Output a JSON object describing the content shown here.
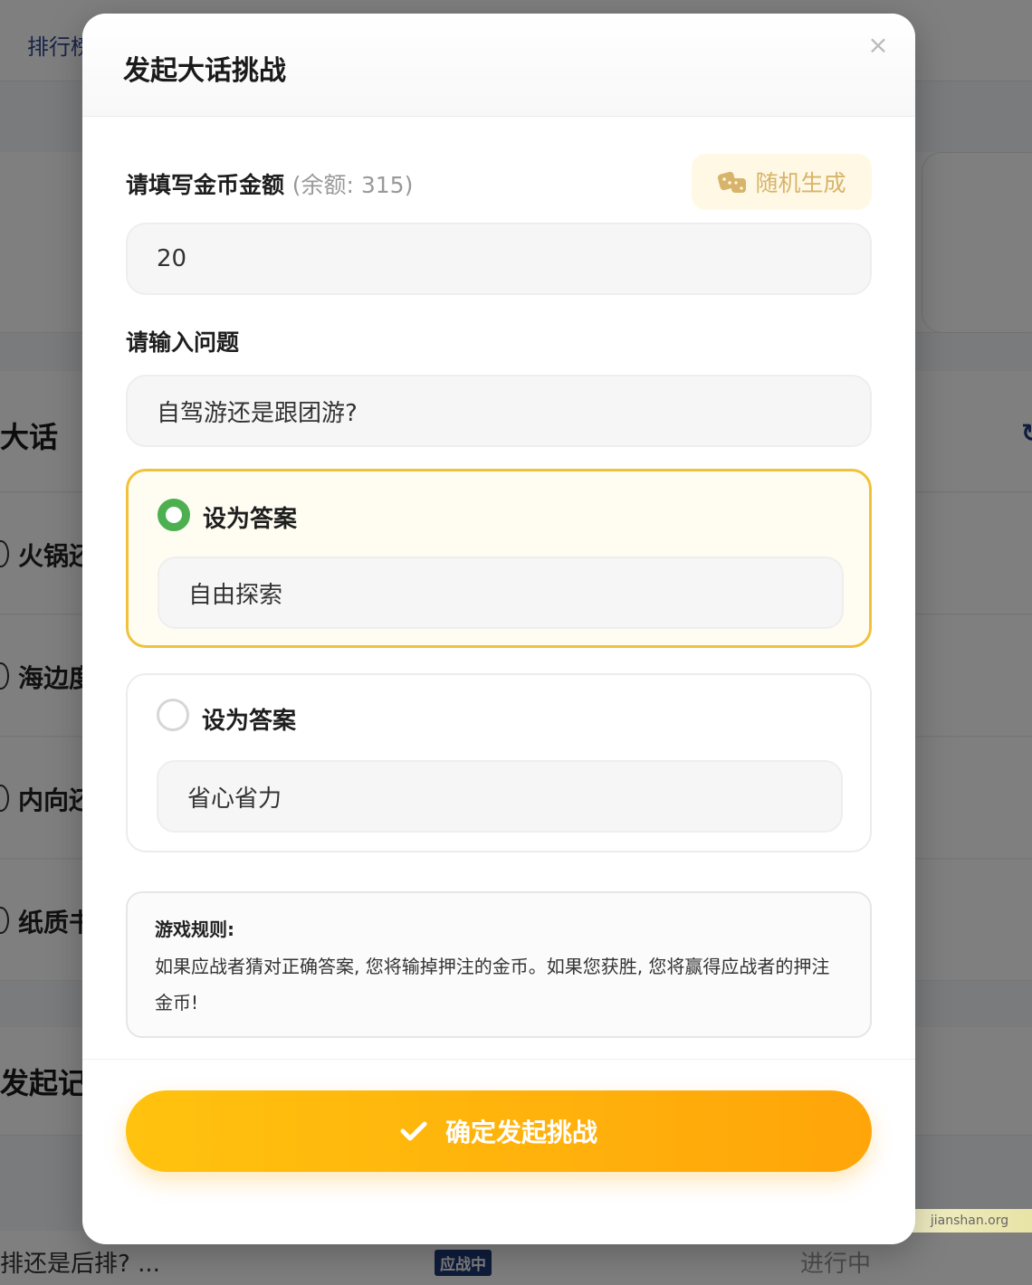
{
  "background": {
    "nav_tab": "排行榜",
    "section_title": "大话",
    "list_items": [
      "火锅还",
      "海边度",
      "内向还",
      "纸质书"
    ],
    "section_title_2": "发起记",
    "bottom_question": "排还是后排? ...",
    "bottom_badge": "应战中",
    "bottom_status": "进行中",
    "watermark": "jianshan.org"
  },
  "modal": {
    "title": "发起大话挑战",
    "close_symbol": "×",
    "amount_label": "请填写金币金额",
    "amount_balance": "(余额: 315)",
    "random_button": "随机生成",
    "amount_value": "20",
    "question_label": "请输入问题",
    "question_value": "自驾游还是跟团游?",
    "answers": [
      {
        "label": "设为答案",
        "value": "自由探索",
        "selected": true
      },
      {
        "label": "设为答案",
        "value": "省心省力",
        "selected": false
      }
    ],
    "rules_title": "游戏规则:",
    "rules_text": "如果应战者猜对正确答案, 您将输掉押注的金币。如果您获胜, 您将赢得应战者的押注金币!",
    "confirm_button": "确定发起挑战"
  },
  "colors": {
    "accent_yellow": "#ffb300",
    "selected_border": "#f0c23a",
    "radio_green": "#4caf50",
    "random_text": "#d7b46a"
  },
  "icons": [
    "close-icon",
    "dice-icon",
    "check-icon"
  ]
}
